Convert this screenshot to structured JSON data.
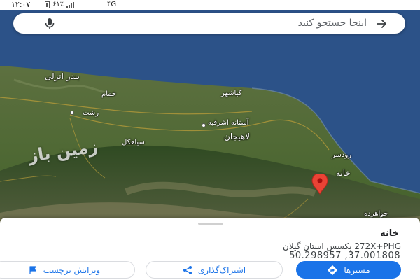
{
  "status_bar": {
    "clock": "۱۲:۰۷",
    "battery": "۶۱٪",
    "network": "۴G",
    "icons": [
      "battery-icon",
      "signal-icon"
    ]
  },
  "search": {
    "placeholder": "اینجا جستجو کنید",
    "icons": [
      "back-arrow-icon",
      "microphone-icon"
    ]
  },
  "map": {
    "labels": {
      "bandar_anzali": "بندر انزلی",
      "khomam": "خمام",
      "rasht": "رشت",
      "kiashahr": "کیاشهر",
      "astaneh": "آستانه اشرفیه",
      "lahijan": "لاهیجان",
      "siahkal": "سیاهکل",
      "rudsar": "رودسر",
      "khaneh": "خانه",
      "javaherdeh": "جواهرده"
    },
    "watermark": "زمین باز",
    "pin_icon": "location-pin-icon"
  },
  "place": {
    "name": "خانه",
    "address": "272X+PHG بکسس استان گیلان",
    "coordinates": "50.298957 ,37.001808"
  },
  "actions": {
    "directions": "مسیرها",
    "share": "اشتراک‌گذاری",
    "edit_label": "ویرایش برچسب"
  },
  "colors": {
    "accent": "#1a73e8",
    "pin": "#ea4335",
    "sea": "#2c5288"
  }
}
